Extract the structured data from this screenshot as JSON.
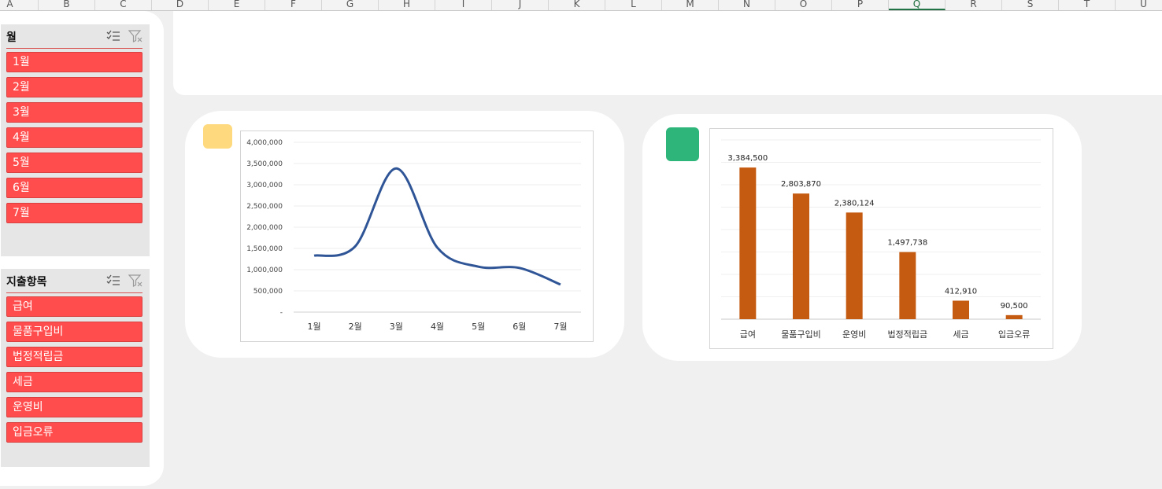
{
  "columns": [
    "A",
    "B",
    "C",
    "D",
    "E",
    "F",
    "G",
    "H",
    "I",
    "J",
    "K",
    "L",
    "M",
    "N",
    "O",
    "P",
    "Q",
    "R",
    "S",
    "T",
    "U"
  ],
  "selected_column": "Q",
  "slicers": [
    {
      "title": "월",
      "items": [
        "1월",
        "2월",
        "3월",
        "4월",
        "5월",
        "6월",
        "7월"
      ]
    },
    {
      "title": "지출항목",
      "items": [
        "급여",
        "물품구입비",
        "법정적립금",
        "세금",
        "운영비",
        "입금오류"
      ]
    }
  ],
  "colors": {
    "slicer_item": "#ff4d4d",
    "line": "#2f5597",
    "bar": "#c55a11",
    "swatch_yellow": "#ffd97d",
    "swatch_green": "#2db57a"
  },
  "icons": {
    "multi_select": "multi-select-icon",
    "clear_filter": "clear-filter-icon"
  },
  "chart_data": [
    {
      "type": "line",
      "categories": [
        "1월",
        "2월",
        "3월",
        "4월",
        "5월",
        "6월",
        "7월"
      ],
      "values": [
        1330000,
        1550000,
        3384500,
        1520000,
        1070000,
        1040000,
        650000
      ],
      "ylim": [
        0,
        4000000
      ],
      "yticks": [
        0,
        500000,
        1000000,
        1500000,
        2000000,
        2500000,
        3000000,
        3500000,
        4000000
      ],
      "ytick_labels": [
        "-",
        "500,000",
        "1,000,000",
        "1,500,000",
        "2,000,000",
        "2,500,000",
        "3,000,000",
        "3,500,000",
        "4,000,000"
      ],
      "grid": true
    },
    {
      "type": "bar",
      "categories": [
        "급여",
        "물품구입비",
        "운영비",
        "법정적립금",
        "세금",
        "입금오류"
      ],
      "values": [
        3384500,
        2803870,
        2380124,
        1497738,
        412910,
        90500
      ],
      "value_labels": [
        "3,384,500",
        "2,803,870",
        "2,380,124",
        "1,497,738",
        "412,910",
        "90,500"
      ],
      "ylim": [
        0,
        4000000
      ],
      "grid": true
    }
  ]
}
